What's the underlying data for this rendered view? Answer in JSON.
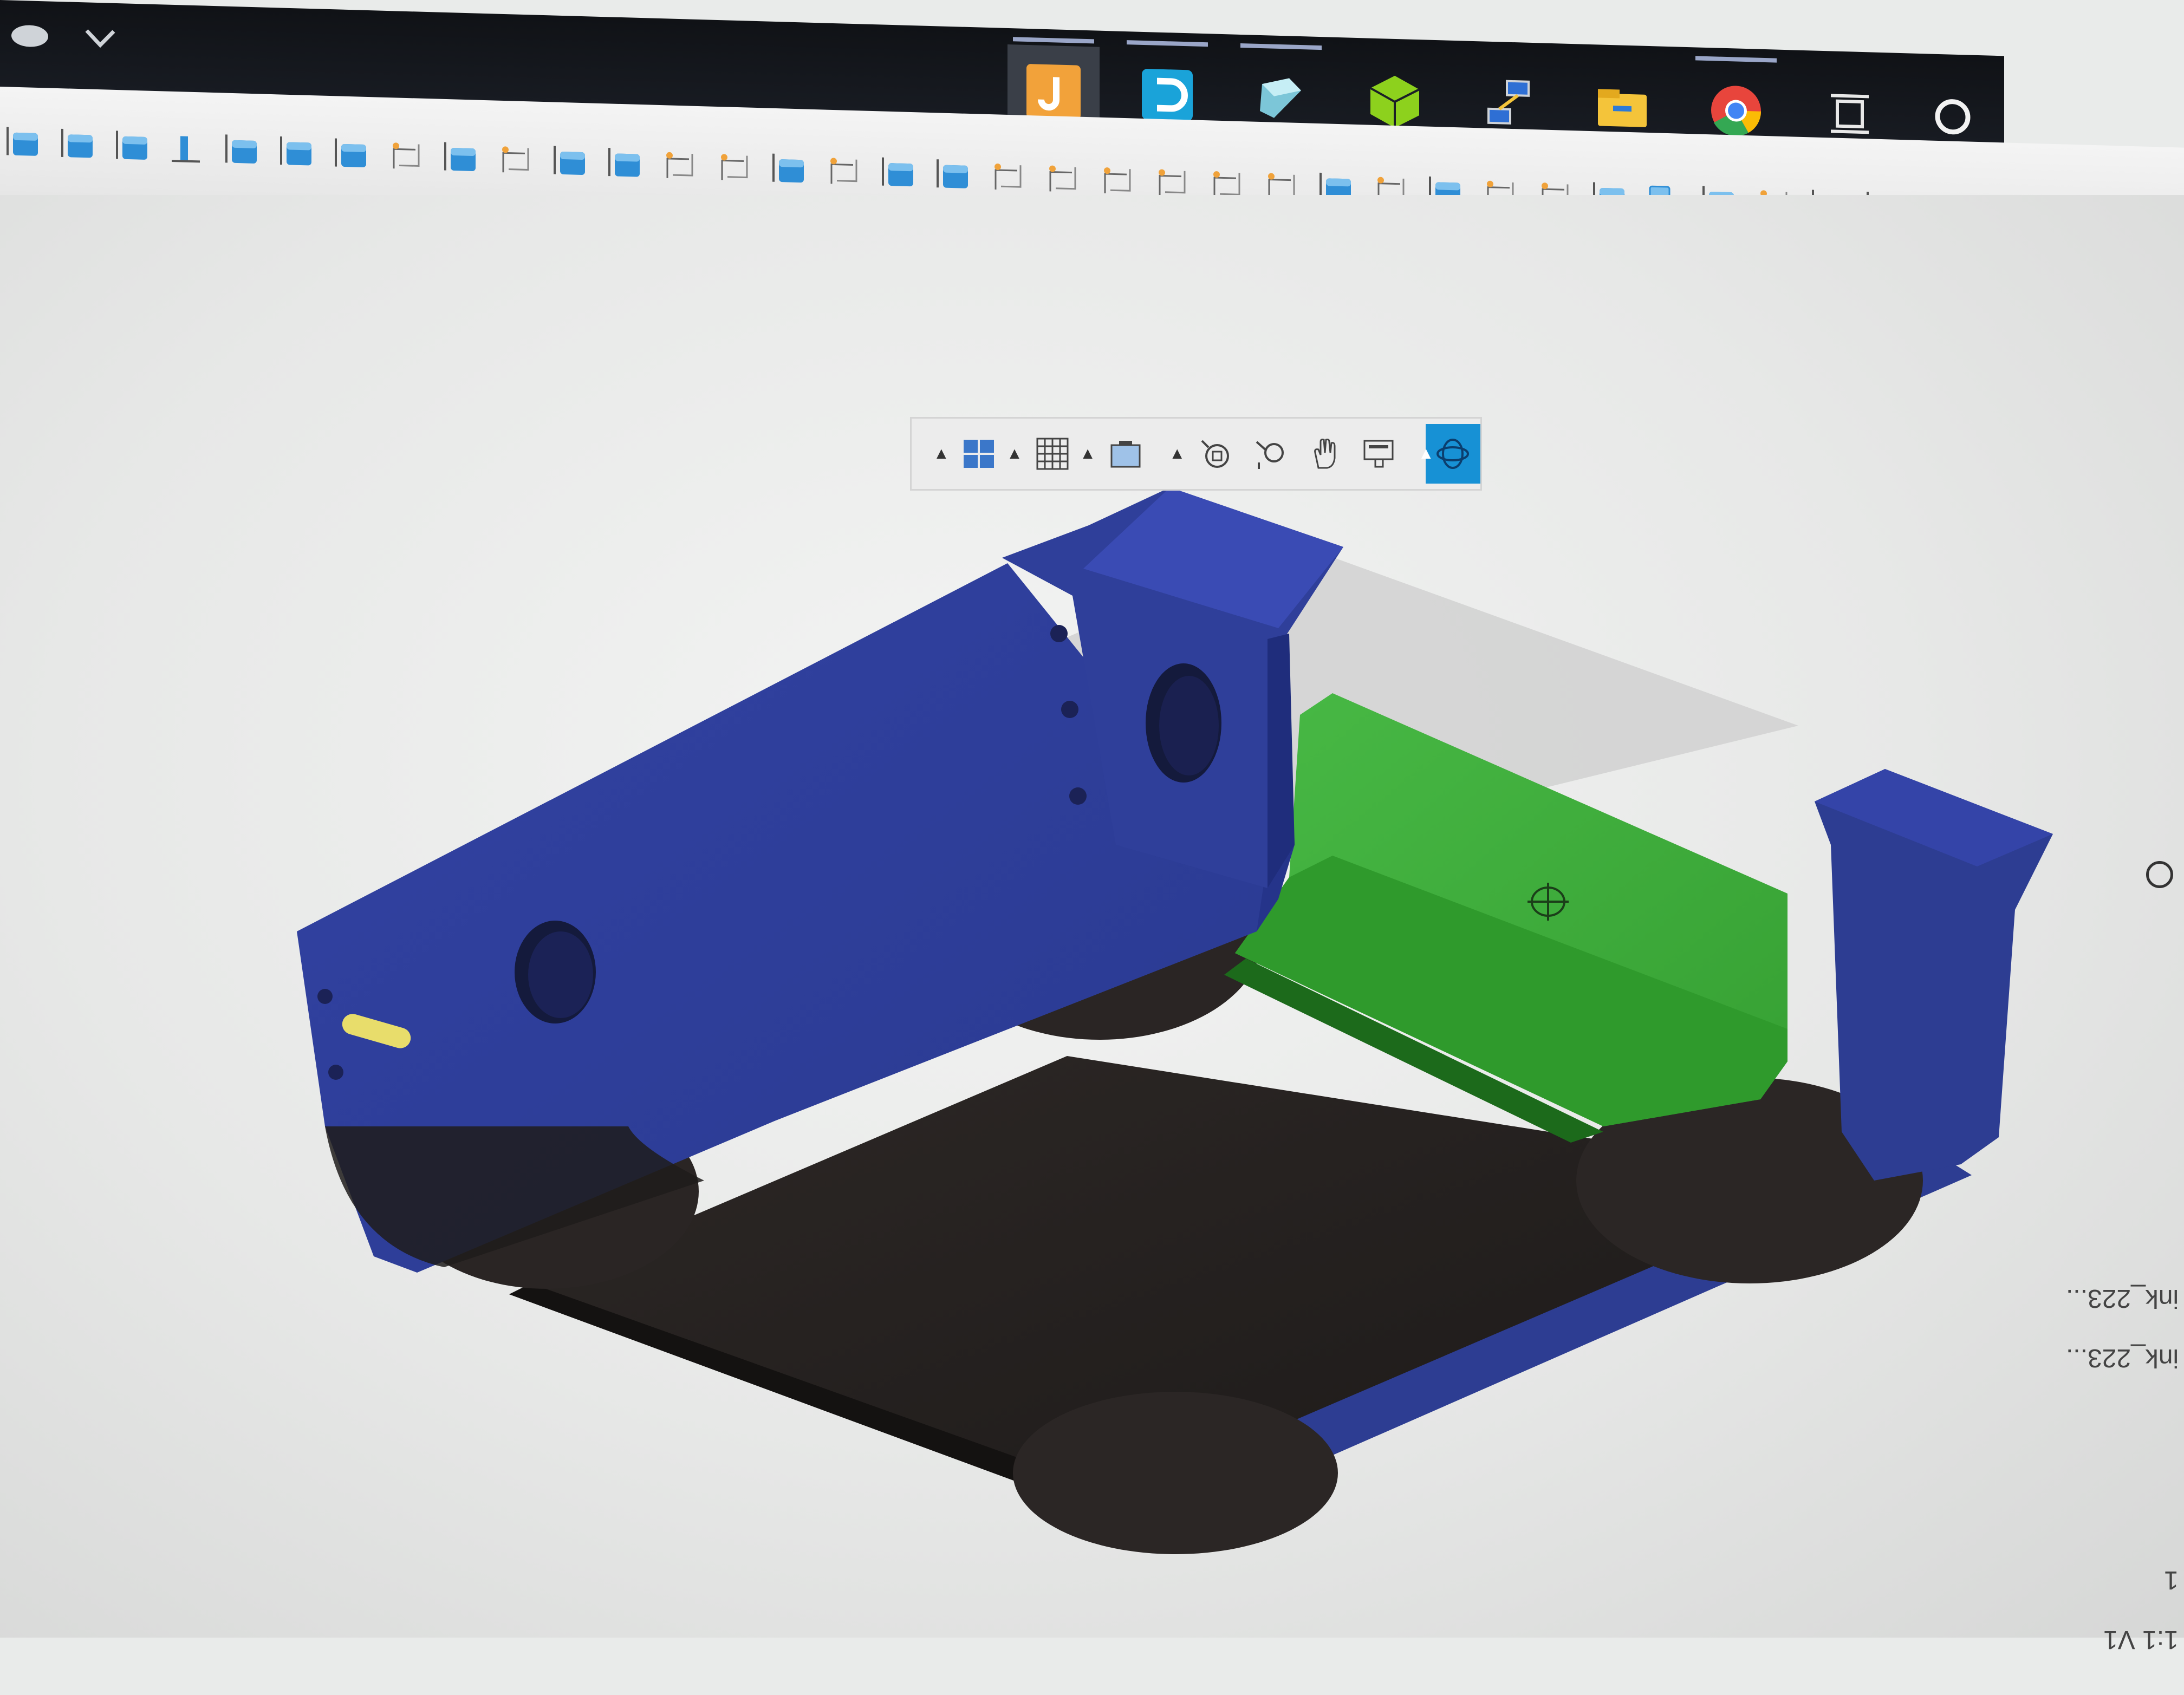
{
  "taskbar": {
    "apps": [
      {
        "name": "fusion-360-app-icon",
        "color": "#f2a23a",
        "active": true
      },
      {
        "name": "dell-support-app-icon",
        "color": "#1aa3d9",
        "active": false
      },
      {
        "name": "3d-viewer-app-icon",
        "color": "#7cc6d8",
        "active": false
      },
      {
        "name": "3d-builder-app-icon",
        "color": "#8dd11d",
        "active": false
      },
      {
        "name": "network-app-icon",
        "color": "#2e6fd4",
        "active": false
      },
      {
        "name": "file-explorer-app-icon",
        "color": "#f4c43a",
        "active": false
      },
      {
        "name": "chrome-app-icon",
        "color": "#e8453c",
        "active": false
      },
      {
        "name": "task-view-icon",
        "color": "#ffffff",
        "active": false
      },
      {
        "name": "cortana-icon",
        "color": "#ffffff",
        "active": false
      }
    ]
  },
  "navbar": {
    "tools": [
      "display-settings-icon",
      "grid-settings-icon",
      "viewports-icon",
      "orbit-icon",
      "free-orbit-icon",
      "pan-icon",
      "look-at-icon",
      "zoom-window-icon"
    ]
  },
  "browser_side": {
    "labels": [
      "ink_223...",
      "ink_223...",
      "1:1 V1",
      "1"
    ]
  },
  "colors": {
    "blue_body": "#2f3f9a",
    "green_rail": "#3eae3a",
    "dark_base": "#231f1e",
    "accent": "#1791d5"
  }
}
